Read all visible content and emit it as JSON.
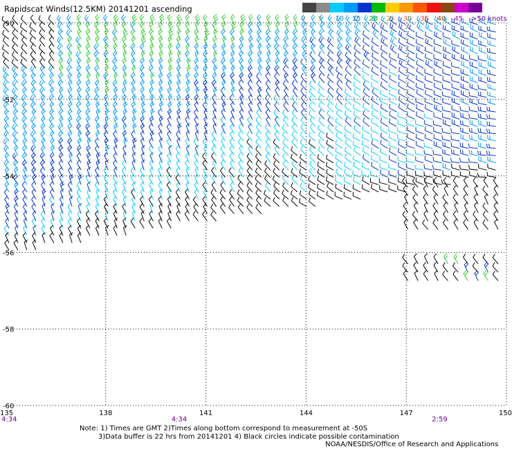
{
  "header": {
    "title": "Rapidscat Winds(12.5KM) 20141201 ascending"
  },
  "legend": {
    "colors": [
      "#444444",
      "#8a8a8a",
      "#00ccff",
      "#0099ff",
      "#0033cc",
      "#00bb00",
      "#ffcc00",
      "#ff9900",
      "#ff5500",
      "#ee1111",
      "#8b4513",
      "#cc00cc",
      "#770099"
    ],
    "labels": [
      "0",
      "5",
      "10",
      "15",
      "20",
      "25",
      "30",
      "35",
      "40",
      "45",
      ">50 knots"
    ],
    "label_colors": [
      "#ccaa00",
      "#ccaa00",
      "#0099cc",
      "#0066cc",
      "#00aa00",
      "#ccaa00",
      "#ff6600",
      "#ff3300",
      "#994411",
      "#cc00cc",
      "#660099"
    ]
  },
  "chart_data": {
    "type": "wind-barb-map",
    "title": "Rapidscat Winds(12.5KM) 20141201 ascending",
    "x_ticks": [
      "135",
      "138",
      "141",
      "144",
      "147",
      "150"
    ],
    "x_values": [
      135,
      138,
      141,
      144,
      147,
      150
    ],
    "y_ticks": [
      "-50",
      "-52",
      "-54",
      "-56",
      "-58",
      "-60"
    ],
    "y_values": [
      -50,
      -52,
      -54,
      -56,
      -58,
      -60
    ],
    "xlim": [
      135,
      150
    ],
    "ylim": [
      -60,
      -50
    ],
    "grid": true,
    "time_labels": [
      {
        "lon": 135,
        "text": "4:34"
      },
      {
        "lon": 140.2,
        "text": "4:34"
      },
      {
        "lon": 148,
        "text": "2:59"
      }
    ],
    "speed_bins_knots": [
      0,
      5,
      10,
      15,
      20,
      25,
      30,
      35,
      40,
      45,
      50
    ],
    "swaths": [
      {
        "name": "main",
        "lon_range": [
          135,
          150
        ],
        "north_lat": -50,
        "south_edge_west_lat": -56.1,
        "south_edge_east_lat": -54.0
      },
      {
        "name": "east-1",
        "lon_range": [
          147,
          150
        ],
        "lat_range": [
          -55.4,
          -54.3
        ]
      },
      {
        "name": "east-2",
        "lon_range": [
          147,
          150
        ],
        "lat_range": [
          -56.9,
          -56.3
        ]
      }
    ]
  },
  "notes": {
    "line1": "Note: 1) Times are GMT 2)Times along bottom correspond to measurement at -50S",
    "line2": "3)Data buffer is 22 hrs from 20141201 4) Black circles indicate possible contamination",
    "line3": "NOAA/NESDIS/Office of Research and Applications"
  }
}
